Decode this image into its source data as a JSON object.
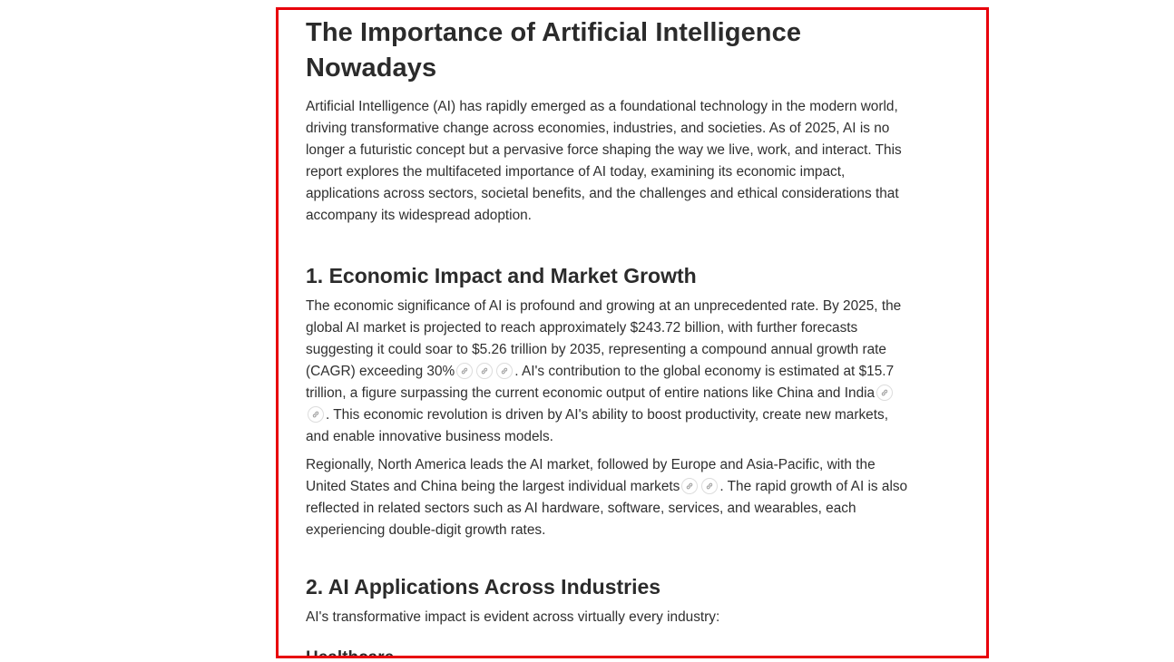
{
  "article": {
    "title": "The Importance of Artificial Intelligence Nowadays",
    "intro": "Artificial Intelligence (AI) has rapidly emerged as a foundational technology in the modern world, driving transformative change across economies, industries, and societies. As of 2025, AI is no longer a futuristic concept but a pervasive force shaping the way we live, work, and interact. This report explores the multifaceted importance of AI today, examining its economic impact, applications across sectors, societal benefits, and the challenges and ethical considerations that accompany its widespread adoption.",
    "section1": {
      "heading": "1. Economic Impact and Market Growth",
      "p1_a": "The economic significance of AI is profound and growing at an unprecedented rate. By 2025, the global AI market is projected to reach approximately $243.72 billion, with further forecasts suggesting it could soar to $5.26 trillion by 2035, representing a compound annual growth rate (CAGR) exceeding 30%",
      "p1_b": ". AI's contribution to the global economy is estimated at $15.7 trillion, a figure surpassing the current economic output of entire nations like China and India",
      "p1_c": ". This economic revolution is driven by AI's ability to boost productivity, create new markets, and enable innovative business models.",
      "p2_a": "Regionally, North America leads the AI market, followed by Europe and Asia-Pacific, with the United States and China being the largest individual markets",
      "p2_b": ". The rapid growth of AI is also reflected in related sectors such as AI hardware, software, services, and wearables, each experiencing double-digit growth rates."
    },
    "section2": {
      "heading": "2. AI Applications Across Industries",
      "intro": "AI's transformative impact is evident across virtually every industry:",
      "subheading": "Healthcare"
    }
  },
  "icons": {
    "citation": "link-icon"
  },
  "colors": {
    "frame_border": "#e8000b",
    "text": "#2f2f2f"
  }
}
